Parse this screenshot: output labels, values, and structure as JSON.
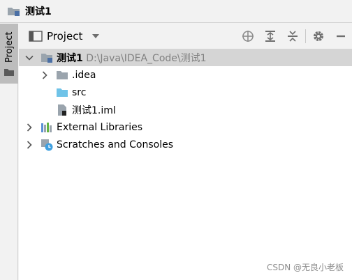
{
  "breadcrumb": {
    "title": "测试1"
  },
  "strip": {
    "tab_label": "Project"
  },
  "panel": {
    "view_label": "Project",
    "tools": [
      "locate-icon",
      "expand-all-icon",
      "collapse-all-icon",
      "gear-icon",
      "hide-icon"
    ]
  },
  "tree": {
    "root": {
      "name": "测试1",
      "path": "D:\\Java\\IDEA_Code\\测试1"
    },
    "idea": {
      "name": ".idea"
    },
    "src": {
      "name": "src"
    },
    "iml": {
      "name": "测试1.iml"
    },
    "external": {
      "name": "External Libraries"
    },
    "scratches": {
      "name": "Scratches and Consoles"
    }
  },
  "colors": {
    "selection": "#d5d5d5",
    "folder_gray": "#9aa4ad",
    "folder_blue": "#6fc3e8"
  },
  "watermark": "CSDN @无良小老板"
}
